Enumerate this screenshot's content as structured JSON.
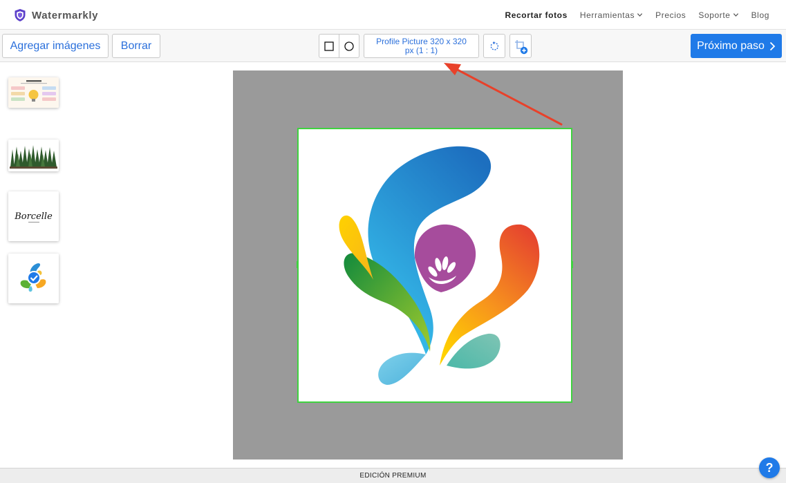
{
  "app": {
    "name": "Watermarkly"
  },
  "nav": {
    "items": [
      {
        "label": "Recortar fotos",
        "active": true,
        "dropdown": false
      },
      {
        "label": "Herramientas",
        "active": false,
        "dropdown": true
      },
      {
        "label": "Precios",
        "active": false,
        "dropdown": false
      },
      {
        "label": "Soporte",
        "active": false,
        "dropdown": true
      },
      {
        "label": "Blog",
        "active": false,
        "dropdown": false
      }
    ]
  },
  "toolbar": {
    "add_images_label": "Agregar imágenes",
    "delete_label": "Borrar",
    "shape_options": [
      "rectangle-crop-icon",
      "circle-crop-icon"
    ],
    "selected_shape": "rectangle",
    "preset_line1": "Profile Picture 320 x 320",
    "preset_line2": "px (1 : 1)",
    "rotate_icon": "rotate-icon",
    "crop_add_icon": "crop-add-icon",
    "next_step_label": "Próximo paso",
    "next_step_icon": "chevron-right-icon"
  },
  "sidebar": {
    "thumbnails": [
      {
        "name": "infographic-thumbnail",
        "label": "INFOGRAPHIC"
      },
      {
        "name": "forest-thumbnail",
        "label": ""
      },
      {
        "name": "borcelle-logo-thumbnail",
        "label": "Borcelle"
      },
      {
        "name": "splash-logo-thumbnail",
        "label": "",
        "selected": true
      }
    ]
  },
  "canvas": {
    "crop_ratio": "1 : 1",
    "image": "colorful-splash-logo"
  },
  "footer": {
    "edition_label": "EDICIÓN PREMIUM"
  },
  "help": {
    "label": "?"
  },
  "colors": {
    "accent": "#1f7ae8",
    "crop_border": "#3fd23f",
    "canvas_bg": "#9a9a9a",
    "annotation_arrow": "#e8412a"
  }
}
